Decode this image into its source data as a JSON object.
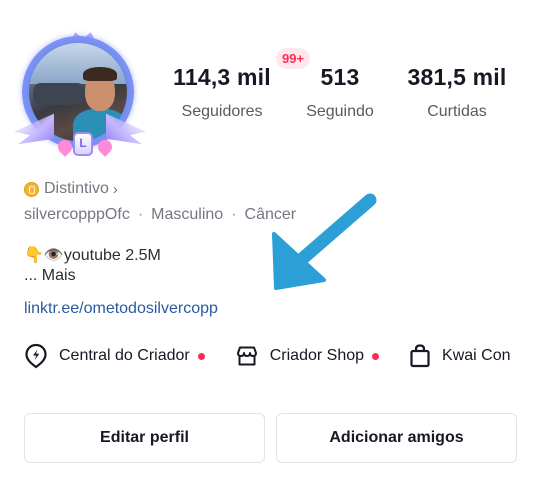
{
  "stats": {
    "followers": {
      "value": "114,3 mil",
      "label": "Seguidores"
    },
    "following": {
      "value": "513",
      "label": "Seguindo"
    },
    "likes": {
      "value": "381,5 mil",
      "label": "Curtidas"
    },
    "notification_badge": "99+"
  },
  "avatar": {
    "level_badge": "L"
  },
  "profile": {
    "badge_label": "Distintivo",
    "username": "silvercopppOfc",
    "gender": "Masculino",
    "sign": "Câncer",
    "separator": "·",
    "bio_line1": "👇👁️youtube 2.5M",
    "bio_more": "...  Mais",
    "link": "linktr.ee/ometodosilvercopp"
  },
  "shortcuts": [
    {
      "label": "Central do Criador",
      "icon": "lightning-location-icon",
      "has_dot": true
    },
    {
      "label": "Criador Shop",
      "icon": "store-icon",
      "has_dot": true
    },
    {
      "label": "Kwai Con",
      "icon": "shopping-bag-icon",
      "has_dot": false
    }
  ],
  "buttons": {
    "edit_profile": "Editar perfil",
    "add_friends": "Adicionar amigos"
  },
  "colors": {
    "accent": "#fe2c55",
    "link": "#2b5aa0",
    "arrow": "#2b9fd6"
  }
}
